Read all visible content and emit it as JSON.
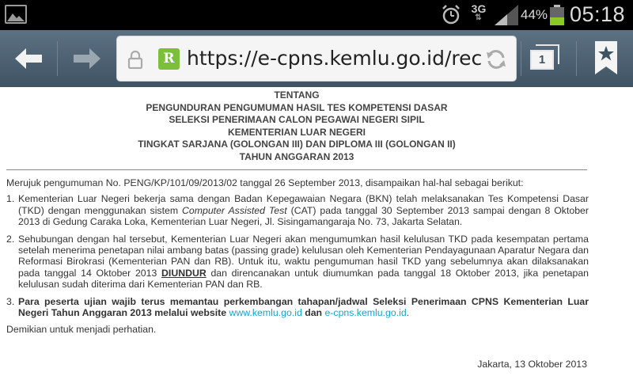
{
  "status_bar": {
    "network": "3G",
    "network_arrows": "⇅",
    "battery_percent": "44%",
    "battery_level": 0.44,
    "time": "05:18"
  },
  "browser": {
    "url": "https://e-cpns.kemlu.go.id/recruit",
    "favicon_letter": "R",
    "tab_count": "1",
    "accent_color": "#7bbf3a"
  },
  "page": {
    "heading": [
      "TENTANG",
      "PENGUNDURAN PENGUMUMAN HASIL TES KOMPETENSI DASAR",
      "SELEKSI PENERIMAAN CALON PEGAWAI NEGERI SIPIL",
      "KEMENTERIAN LUAR NEGERI",
      "TINGKAT SARJANA (GOLONGAN III) DAN DIPLOMA III (GOLONGAN II)",
      "TAHUN ANGGARAN 2013"
    ],
    "intro": "Merujuk pengumuman No. PENG/KP/101/09/2013/02 tanggal 26 September 2013, disampaikan hal-hal sebagai berikut:",
    "items": [
      {
        "num": "1.",
        "part_a": "Kementerian Luar Negeri bekerja sama dengan Badan Kepegawaian Negara (BKN) telah melaksanakan Tes Kompetensi Dasar (TKD) dengan menggunakan sistem ",
        "part_b_italic": "Computer Assisted Test",
        "part_c": " (CAT) pada tanggal 30 September 2013 sampai dengan 8 Oktober 2013 di Gedung Caraka Loka, Kementerian Luar Negeri, Jl. Sisingamangaraja No. 73, Jakarta Selatan."
      },
      {
        "num": "2.",
        "part_a": "Sehubungan dengan hal tersebut, Kementerian Luar Negeri akan mengumumkan hasil kelulusan TKD pada kesempatan pertama setelah menerima penetapan nilai ambang batas (passing grade) kelulusan oleh Kementerian Pendayagunaan Aparatur Negara dan Reformasi Birokrasi (Kementerian PAN dan RB). Untuk itu, waktu pengumuman hasil TKD yang sebelumnya akan dilaksanakan pada tanggal 14 Oktober 2013 ",
        "part_b_underline": "DIUNDUR",
        "part_c": " dan direncanakan untuk diumumkan pada tanggal 18 Oktober 2013, jika penetapan kelulusan sudah diterima dari Kementerian PAN dan RB."
      },
      {
        "num": "3.",
        "part_a_bold": "Para peserta ujian wajib terus memantau perkembangan tahapan/jadwal Seleksi Penerimaan CPNS Kementerian Luar Negeri Tahun Anggaran 2013 melalui website ",
        "link1": "www.kemlu.go.id",
        "mid_bold": " dan ",
        "link2": "e-cpns.kemlu.go.id",
        "end": "."
      }
    ],
    "closing": "Demikian untuk menjadi perhatian.",
    "signoff": "Jakarta, 13 Oktober 2013"
  }
}
